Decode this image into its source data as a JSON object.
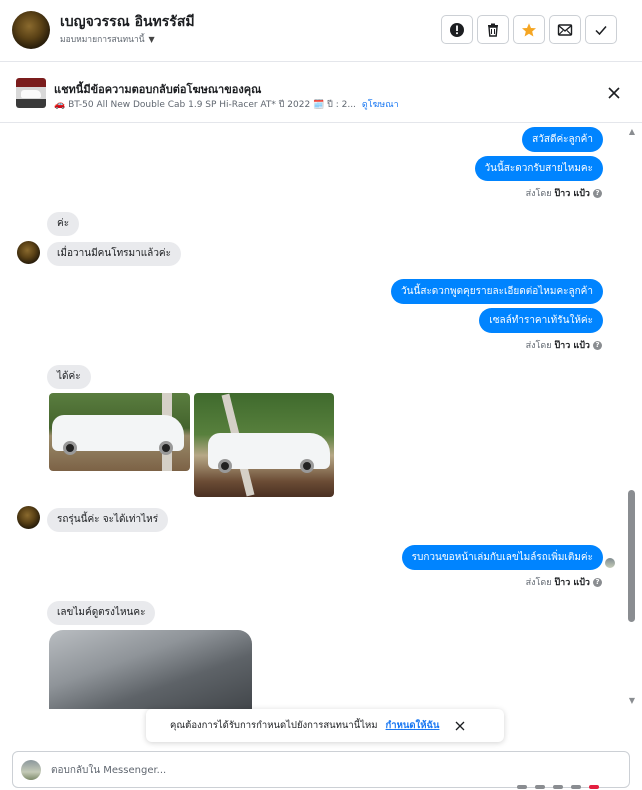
{
  "header": {
    "name": "เบญจวรรณ อินทรรัสมี",
    "assign_label": "มอบหมายการสนทนานี้",
    "actions": [
      {
        "name": "report",
        "icon": "exclamation-circle-icon"
      },
      {
        "name": "delete",
        "icon": "trash-icon"
      },
      {
        "name": "star",
        "icon": "star-icon"
      },
      {
        "name": "mark-unread",
        "icon": "envelope-icon"
      },
      {
        "name": "done",
        "icon": "checkmark-icon"
      }
    ],
    "star_color": "#f5a623"
  },
  "ad": {
    "title": "แชทนี้มีข้อความตอบกลับต่อโฆษณาของคุณ",
    "subtitle": "🚗 BT-50 All New Double Cab 1.9 SP Hi-Racer AT* ปี 2022 🗓️ ปี : 2...",
    "link": "ดูโฆษณา"
  },
  "messages": {
    "out1": "สวัสดีค่ะลูกค้า",
    "out2": "วันนี้สะดวกรับสายไหมคะ",
    "sent_by_1": {
      "prefix": "ส่งโดย",
      "name": "ป๊าว แป้ว"
    },
    "in1": "ค่ะ",
    "in2": "เมื่อวานมีคนโทรมาแล้วค่ะ",
    "out3": "วันนี้สะดวกพูดคุยรายละเอียดต่อไหมคะลูกค้า",
    "out4": "เซลล์ทำราคาเท้รันให้ค่ะ",
    "sent_by_2": {
      "prefix": "ส่งโดย",
      "name": "ป๊าว แป้ว"
    },
    "in3": "ได้ค่ะ",
    "in4": "รถรุ่นนี้ค่ะ จะได้เท่าไหร่",
    "out5": "รบกวนขอหน้าเล่มกับเลขไมล์รถเพิ่มเติมค่ะ",
    "sent_by_3": {
      "prefix": "ส่งโดย",
      "name": "ป๊าว แป้ว"
    },
    "in5": "เลขไมค์ดูตรงไหนคะ",
    "accent": "#0084ff"
  },
  "toast": {
    "text": "คุณต้องการได้รับการกำหนดไปยังการสนทนานี้ไหม",
    "link": "กำหนดให้ฉัน"
  },
  "composer": {
    "placeholder": "ตอบกลับใน Messenger..."
  }
}
